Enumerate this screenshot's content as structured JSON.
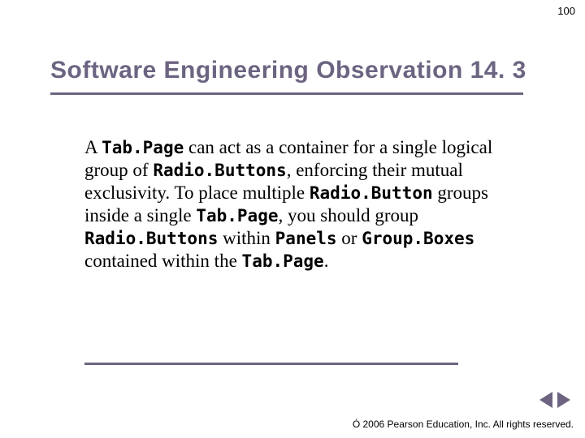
{
  "page_number": "100",
  "title": "Software Engineering Observation 14. 3",
  "body": {
    "t0": "A ",
    "c0": "Tab.Page",
    "t1": " can act as a container for a single logical group of ",
    "c1": "Radio.Buttons",
    "t2": ", enforcing their mutual exclusivity. To place multiple ",
    "c2": "Radio.Button",
    "t3": " groups inside a single ",
    "c3": "Tab.Page",
    "t4": ", you should group ",
    "c4": "Radio.Buttons",
    "t5": " within ",
    "c5": "Panels",
    "t6": " or ",
    "c6": "Group.Boxes",
    "t7": " contained within the ",
    "c7": "Tab.Page",
    "t8": "."
  },
  "footer": "Ó 2006 Pearson Education, Inc.  All rights reserved."
}
